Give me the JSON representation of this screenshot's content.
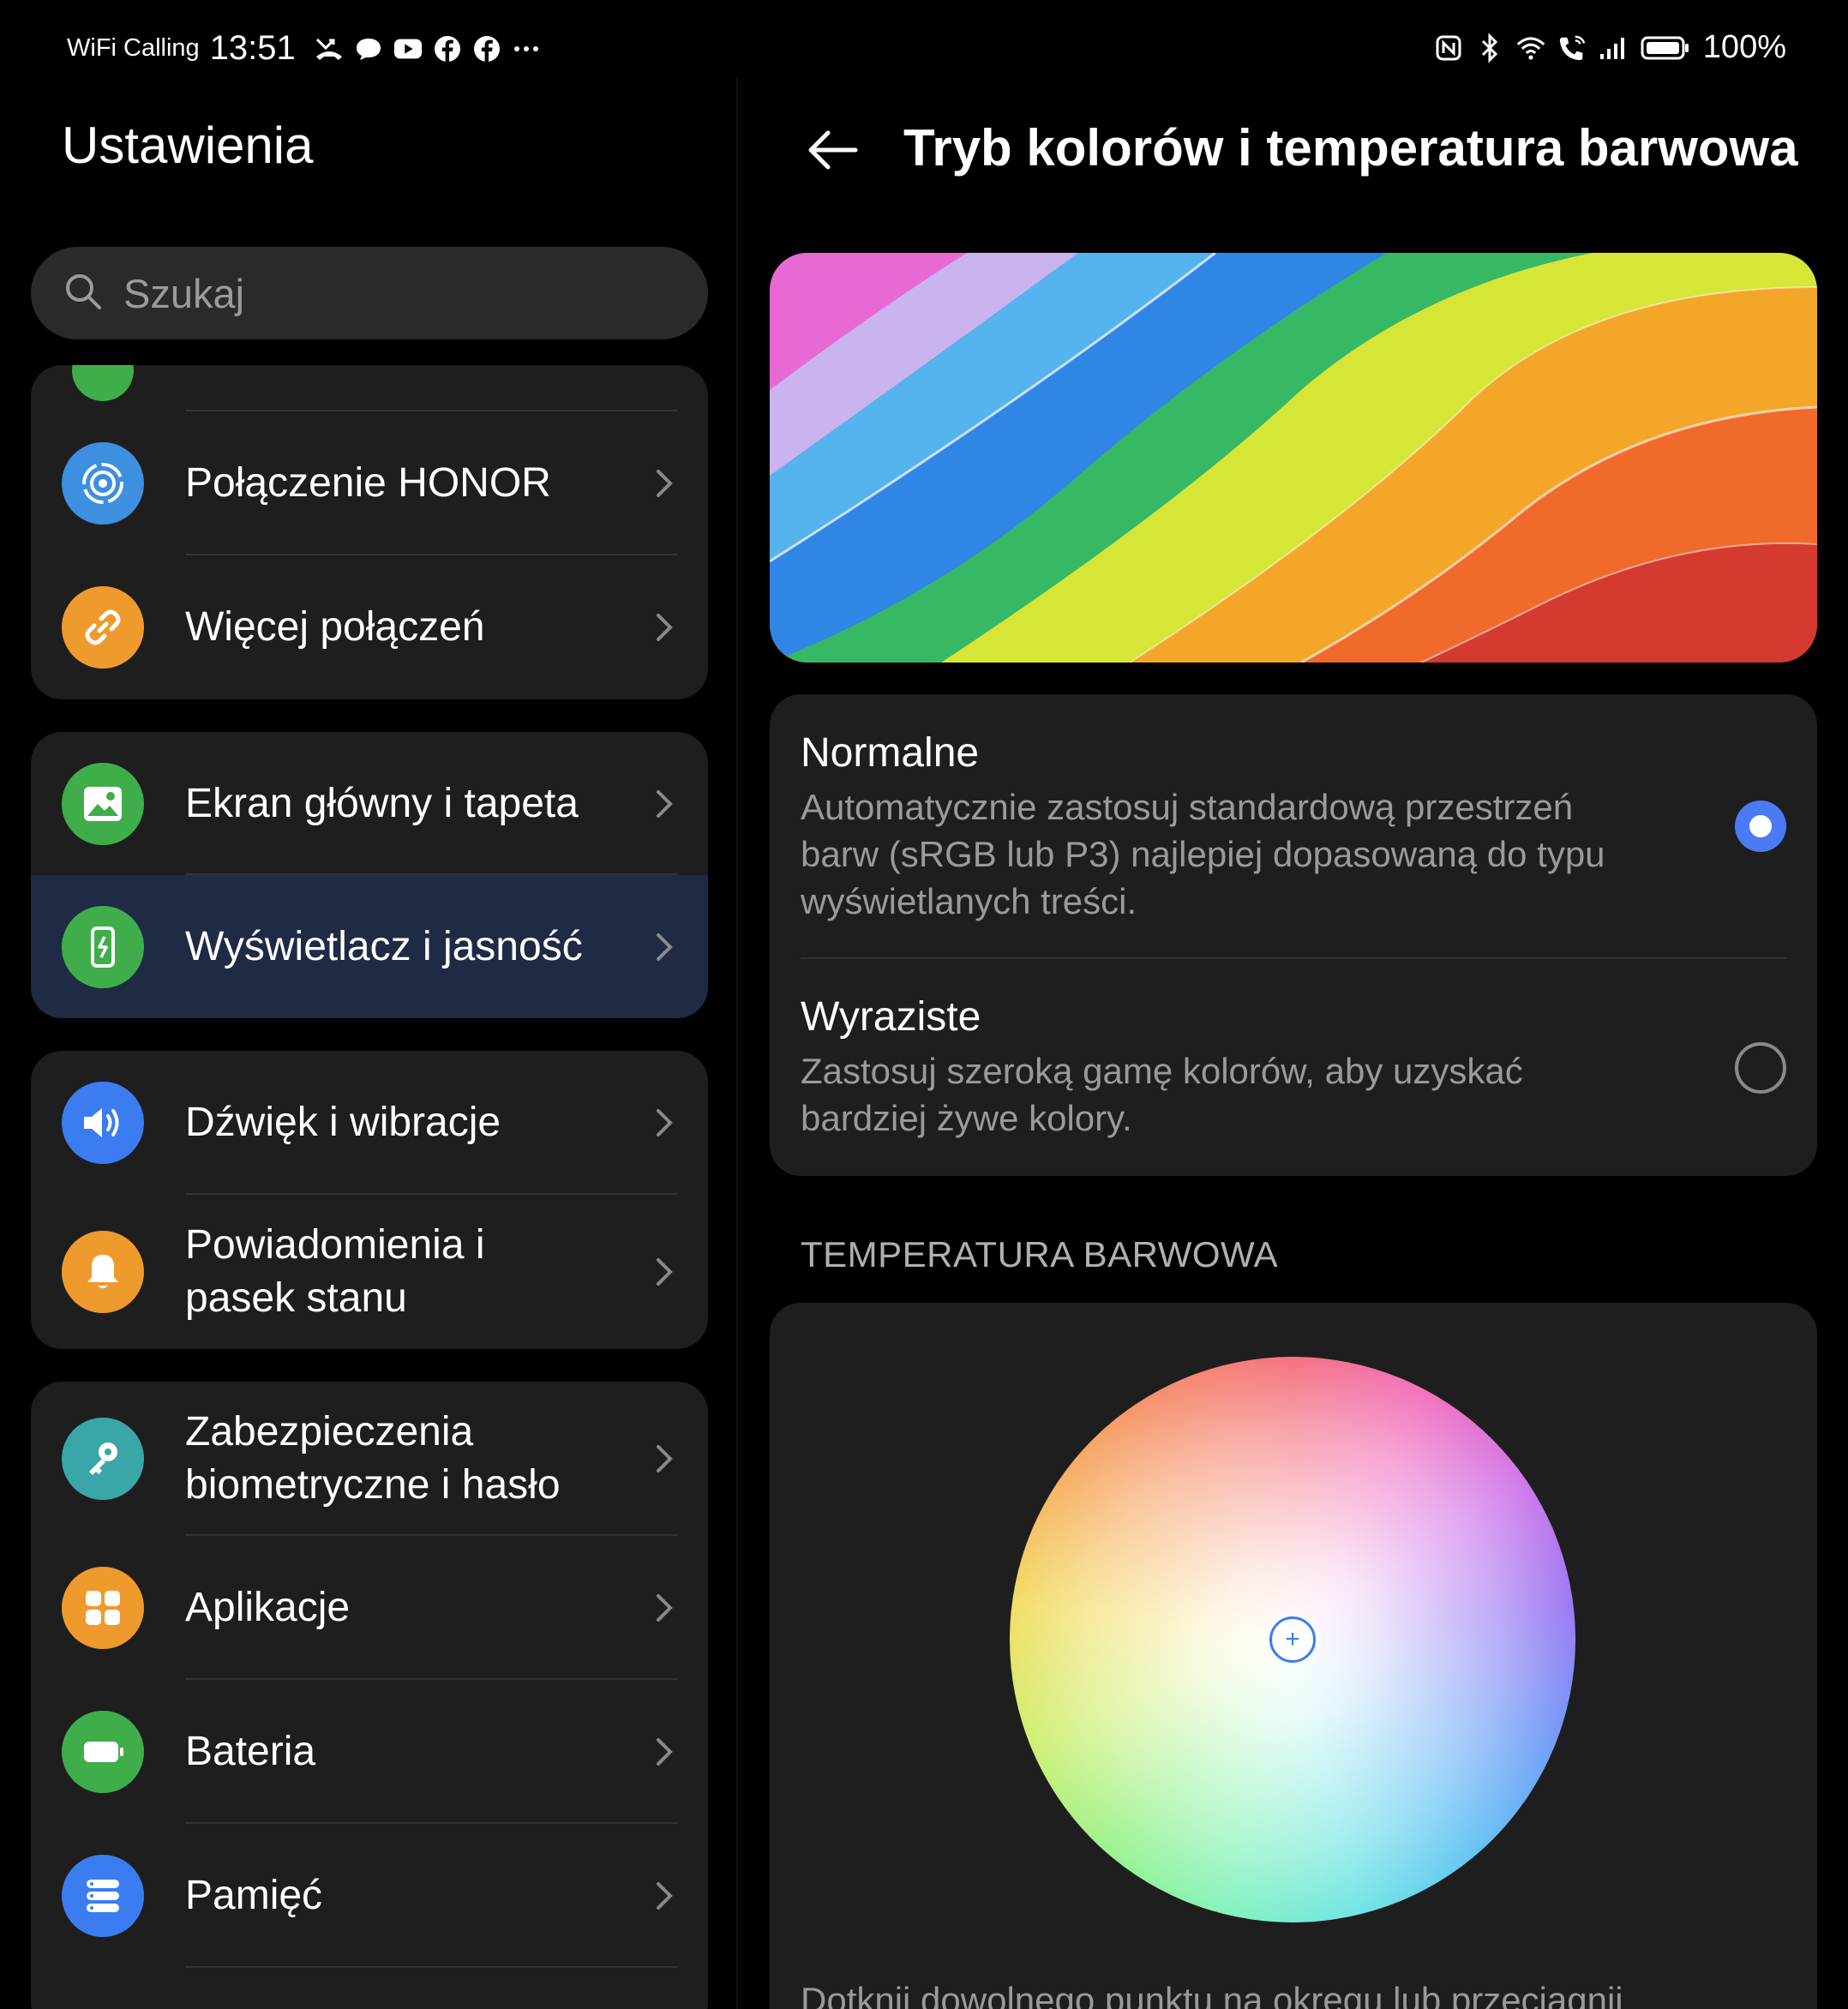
{
  "status_bar": {
    "carrier": "WiFi Calling",
    "time": "13:51",
    "notification_icons": [
      "missed-call-icon",
      "chat-bubble-icon",
      "youtube-icon",
      "facebook-icon",
      "facebook-icon",
      "more-dots-icon"
    ],
    "system_icons": [
      "nfc-icon",
      "bluetooth-icon",
      "wifi-icon",
      "wifi-calling-icon",
      "signal-icon",
      "battery-icon"
    ],
    "battery": "100%"
  },
  "settings": {
    "title": "Ustawienia",
    "search": {
      "placeholder": "Szukaj"
    },
    "groups": [
      {
        "items": [
          {
            "label": "Połączenie HONOR",
            "icon": "honor-connect-icon",
            "color": "#3d8fe0"
          },
          {
            "label": "Więcej połączeń",
            "icon": "link-icon",
            "color": "#ef9a2d"
          }
        ]
      },
      {
        "items": [
          {
            "label": "Ekran główny i tapeta",
            "icon": "wallpaper-icon",
            "color": "#3fae4a"
          },
          {
            "label": "Wyświetlacz i jasność",
            "icon": "display-brightness-icon",
            "color": "#3fae4a",
            "selected": true
          }
        ]
      },
      {
        "items": [
          {
            "label": "Dźwięk i wibracje",
            "icon": "speaker-icon",
            "color": "#3b7cf0"
          },
          {
            "label": "Powiadomienia i pasek stanu",
            "icon": "bell-icon",
            "color": "#ef9a2d"
          }
        ]
      },
      {
        "items": [
          {
            "label": "Zabezpieczenia biometryczne i hasło",
            "icon": "key-icon",
            "color": "#3aa6a8"
          },
          {
            "label": "Aplikacje",
            "icon": "apps-grid-icon",
            "color": "#ef9a2d"
          },
          {
            "label": "Bateria",
            "icon": "battery-icon",
            "color": "#3fae4a"
          },
          {
            "label": "Pamięć",
            "icon": "storage-icon",
            "color": "#3b7cf0"
          }
        ]
      }
    ]
  },
  "detail": {
    "title": "Tryb kolorów i temperatura barwowa",
    "modes": [
      {
        "title": "Normalne",
        "description": "Automatycznie zastosuj standardową przestrzeń barw (sRGB lub P3) najlepiej dopasowaną do typu wyświetlanych treści.",
        "selected": true
      },
      {
        "title": "Wyraziste",
        "description": "Zastosuj szeroką gamę kolorów, aby uzyskać bardziej żywe kolory.",
        "selected": false
      }
    ],
    "temperature_section": "TEMPERATURA BARWOWA",
    "wheel_hint": "Dotknij dowolnego punktu na okręgu lub przeciągnij"
  },
  "colors": {
    "accent": "#4a7bf5",
    "card": "#1e1e1e",
    "selected_row": "#1f2a45"
  }
}
